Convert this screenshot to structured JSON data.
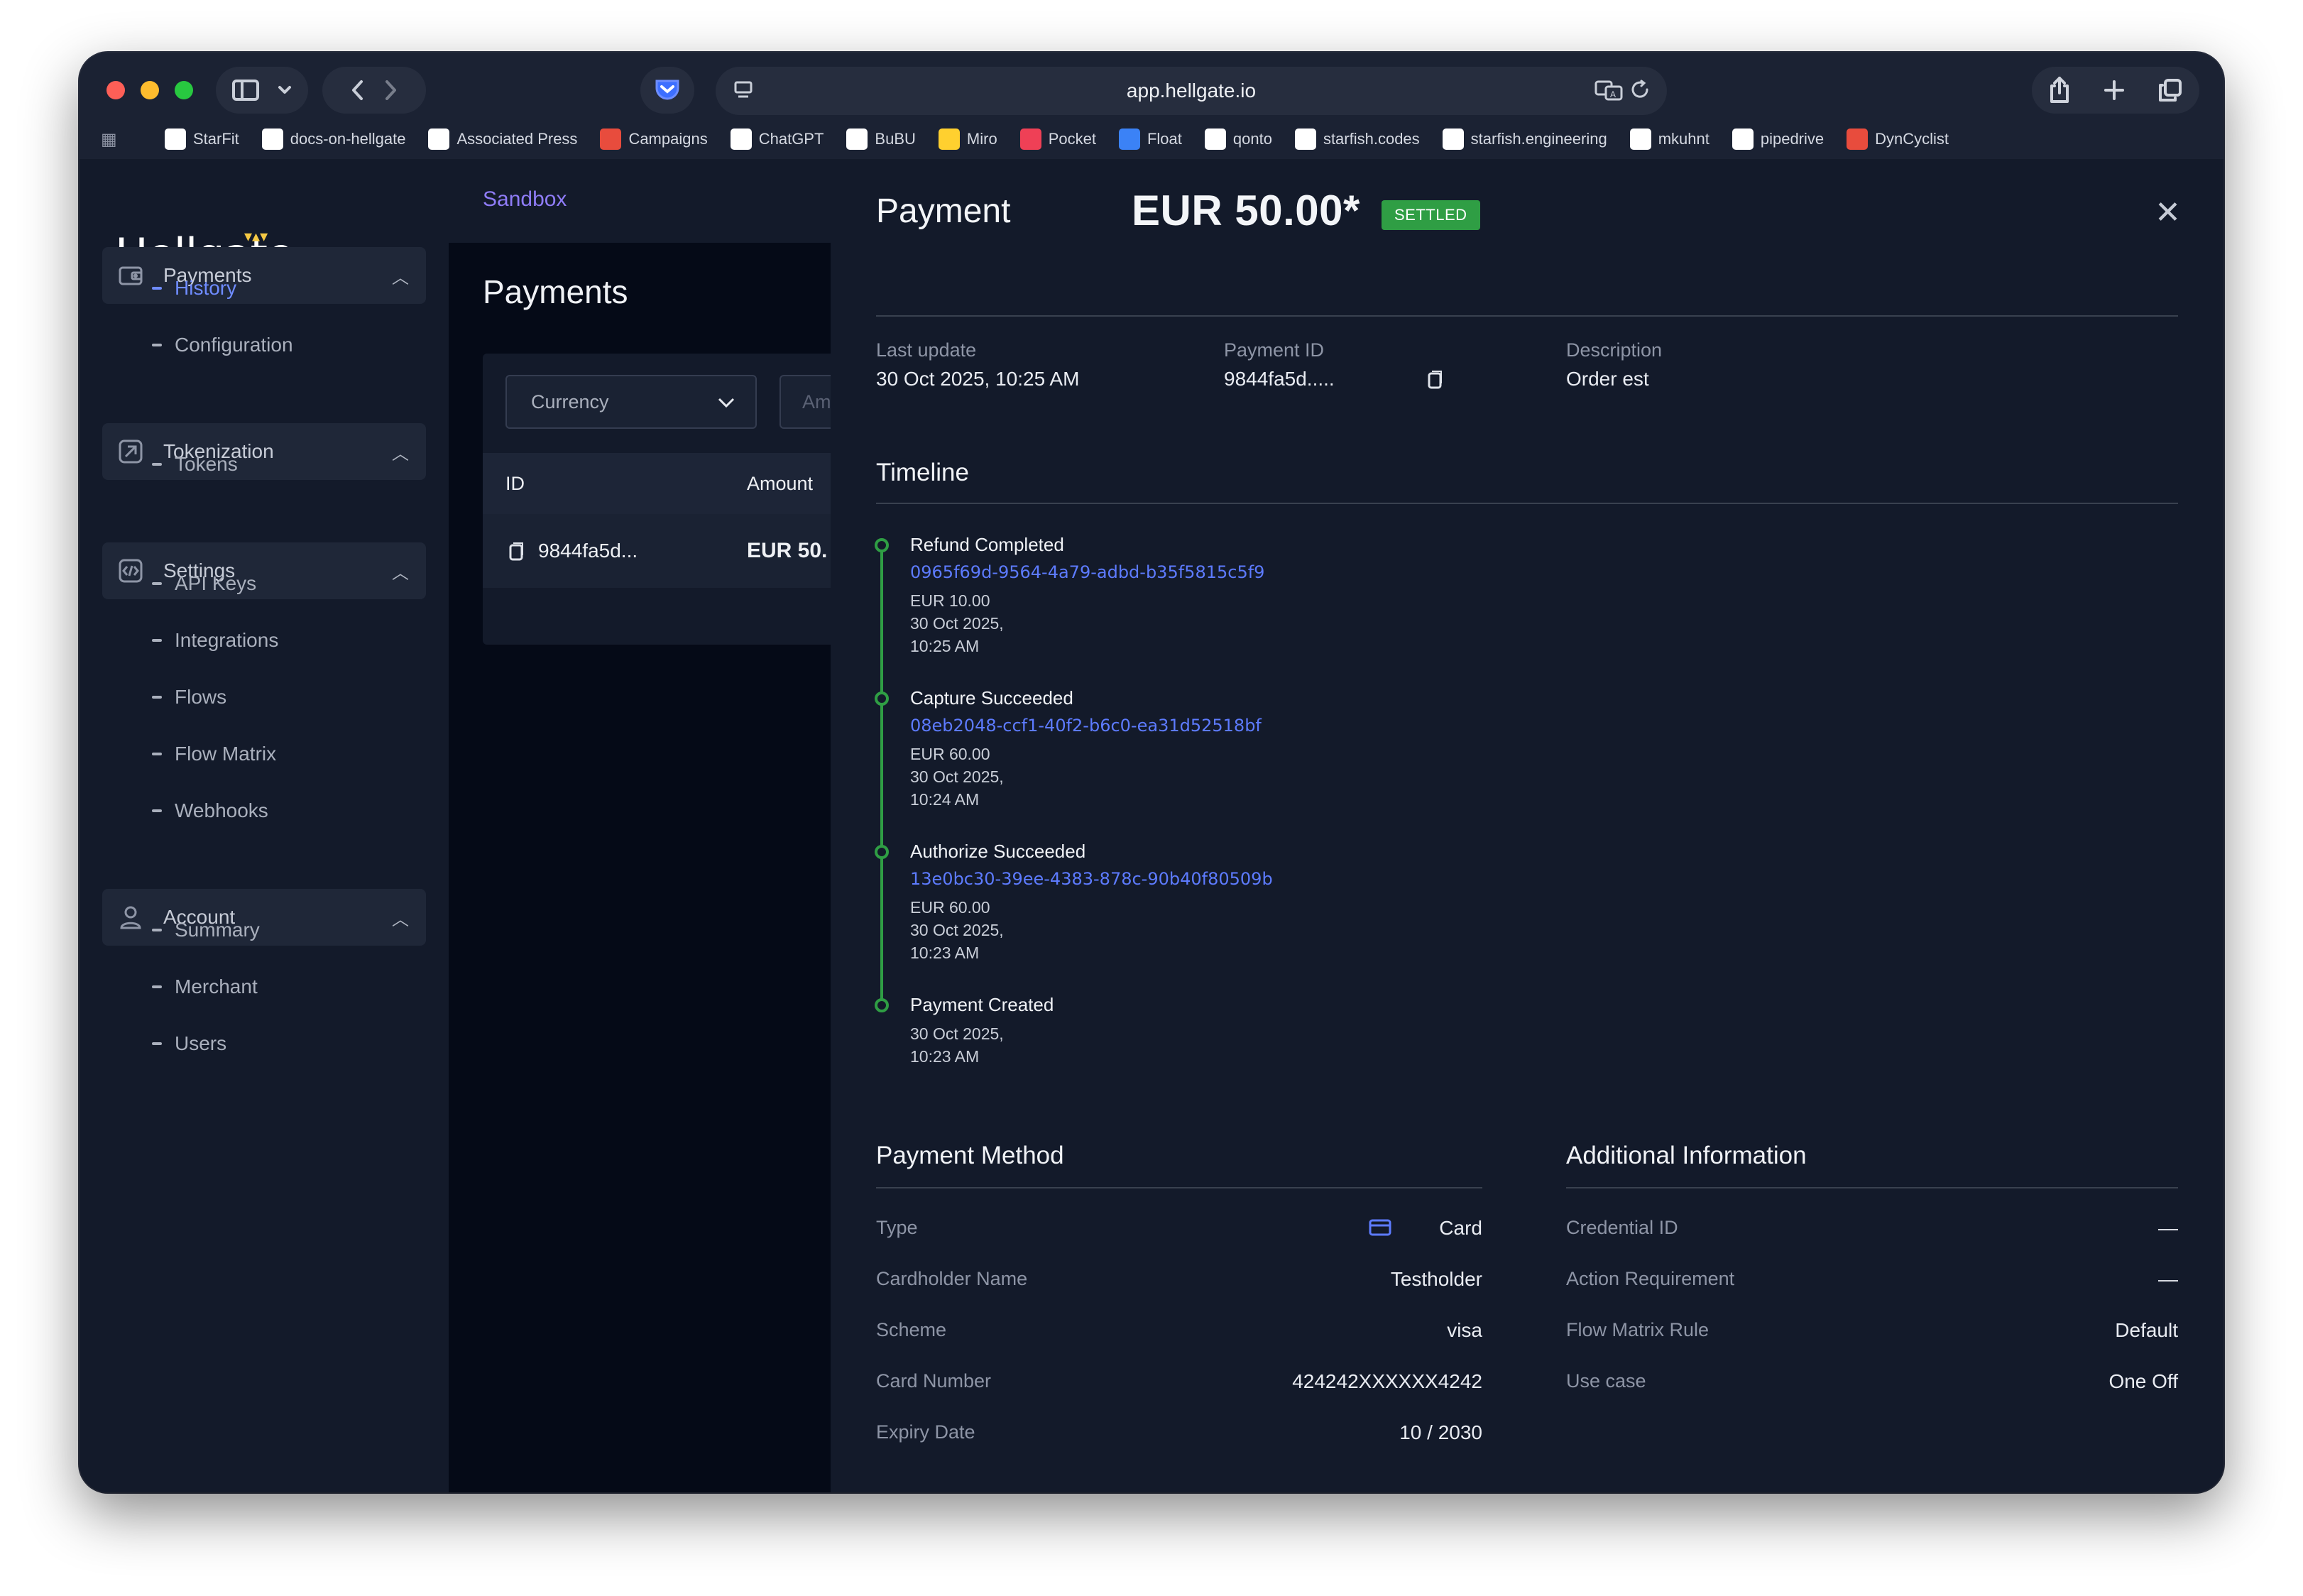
{
  "browser": {
    "url": "app.hellgate.io",
    "bookmarks": [
      {
        "label": "StarFit",
        "icon": "starfit-icon",
        "color": "#ffffff"
      },
      {
        "label": "docs-on-hellgate",
        "icon": "docs-icon",
        "color": "#ffffff"
      },
      {
        "label": "Associated Press",
        "icon": "ap-icon",
        "color": "#ffffff"
      },
      {
        "label": "Campaigns",
        "icon": "campaigns-icon",
        "color": "#e84c3d"
      },
      {
        "label": "ChatGPT",
        "icon": "chatgpt-icon",
        "color": "#ffffff"
      },
      {
        "label": "BuBU",
        "icon": "bubu-icon",
        "color": "#ffffff"
      },
      {
        "label": "Miro",
        "icon": "miro-icon",
        "color": "#ffd02f"
      },
      {
        "label": "Pocket",
        "icon": "pocket-icon",
        "color": "#ef4056"
      },
      {
        "label": "Float",
        "icon": "float-icon",
        "color": "#3b82f6"
      },
      {
        "label": "qonto",
        "icon": "qonto-icon",
        "color": "#ffffff"
      },
      {
        "label": "starfish.codes",
        "icon": "github-icon",
        "color": "#ffffff"
      },
      {
        "label": "starfish.engineering",
        "icon": "github-icon",
        "color": "#ffffff"
      },
      {
        "label": "mkuhnt",
        "icon": "github-icon",
        "color": "#ffffff"
      },
      {
        "label": "pipedrive",
        "icon": "pipedrive-icon",
        "color": "#ffffff"
      },
      {
        "label": "DynCyclist",
        "icon": "dyncyclist-icon",
        "color": "#e84c3d"
      }
    ]
  },
  "sidebar": {
    "logo": "Hellgate",
    "groups": [
      {
        "label": "Payments",
        "icon": "wallet-icon",
        "items": [
          "History",
          "Configuration"
        ],
        "active": "History"
      },
      {
        "label": "Tokenization",
        "icon": "token-icon",
        "items": [
          "Tokens"
        ]
      },
      {
        "label": "Settings",
        "icon": "code-icon",
        "items": [
          "API Keys",
          "Integrations",
          "Flows",
          "Flow Matrix",
          "Webhooks"
        ]
      },
      {
        "label": "Account",
        "icon": "user-icon",
        "items": [
          "Summary",
          "Merchant",
          "Users"
        ]
      }
    ]
  },
  "payments_list": {
    "environment": "Sandbox",
    "title": "Payments",
    "currency_placeholder": "Currency",
    "amount_placeholder": "Am",
    "columns": [
      "ID",
      "Amount"
    ],
    "rows": [
      {
        "id": "9844fa5d...",
        "amount": "EUR 50."
      }
    ]
  },
  "detail": {
    "title": "Payment",
    "amount": "EUR 50.00*",
    "status": "SETTLED",
    "meta": [
      {
        "label": "Last update",
        "value": "30 Oct 2025, 10:25 AM"
      },
      {
        "label": "Payment ID",
        "value": "9844fa5d....."
      },
      {
        "label": "Description",
        "value": "Order est"
      }
    ],
    "timeline_title": "Timeline",
    "timeline": [
      {
        "title": "Refund Completed",
        "id": "0965f69d-9564-4a79-adbd-b35f5815c5f9",
        "amount": "EUR 10.00",
        "date": "30 Oct 2025,",
        "time": "10:25 AM"
      },
      {
        "title": "Capture Succeeded",
        "id": "08eb2048-ccf1-40f2-b6c0-ea31d52518bf",
        "amount": "EUR 60.00",
        "date": "30 Oct 2025,",
        "time": "10:24 AM"
      },
      {
        "title": "Authorize Succeeded",
        "id": "13e0bc30-39ee-4383-878c-90b40f80509b",
        "amount": "EUR 60.00",
        "date": "30 Oct 2025,",
        "time": "10:23 AM"
      },
      {
        "title": "Payment Created",
        "date": "30 Oct 2025,",
        "time": "10:23 AM"
      }
    ],
    "payment_method": {
      "title": "Payment Method",
      "rows": [
        {
          "label": "Type",
          "value": "Card"
        },
        {
          "label": "Cardholder Name",
          "value": "Testholder"
        },
        {
          "label": "Scheme",
          "value": "visa"
        },
        {
          "label": "Card Number",
          "value": "424242XXXXXX4242"
        },
        {
          "label": "Expiry Date",
          "value": "10 / 2030"
        }
      ]
    },
    "additional_info": {
      "title": "Additional Information",
      "rows": [
        {
          "label": "Credential ID",
          "value": "—"
        },
        {
          "label": "Action Requirement",
          "value": "—"
        },
        {
          "label": "Flow Matrix Rule",
          "value": "Default"
        },
        {
          "label": "Use case",
          "value": "One Off"
        }
      ]
    }
  }
}
